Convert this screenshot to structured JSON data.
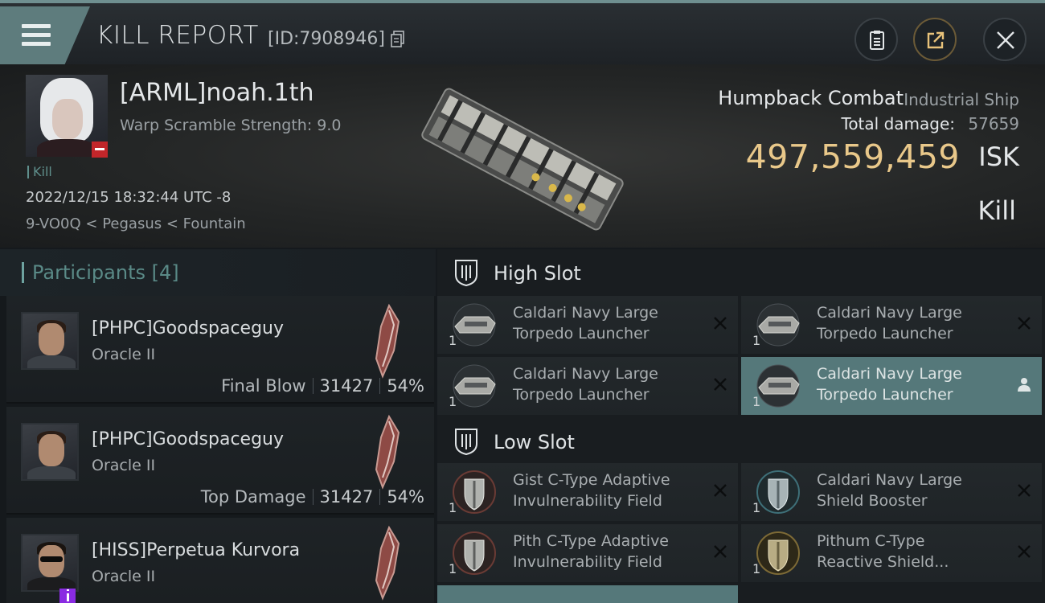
{
  "header": {
    "title": "KILL REPORT",
    "id_label": "[ID:7908946]"
  },
  "victim": {
    "name": "[ARML]noah.1th",
    "warp_scramble": "Warp Scramble Strength: 9.0",
    "tag": "Kill",
    "timestamp": "2022/12/15 18:32:44 UTC -8",
    "location": "9-VO0Q < Pegasus < Fountain",
    "ship_name": "Humpback Combat",
    "ship_class": "Industrial Ship",
    "total_damage_label": "Total damage:",
    "total_damage_value": "57659",
    "isk_value": "497,559,459",
    "isk_unit": "ISK",
    "result": "Kill"
  },
  "participants": {
    "title": "Participants",
    "count": "[4]",
    "rows": [
      {
        "name": "[PHPC]Goodspaceguy",
        "ship": "Oracle II",
        "label": "Final Blow",
        "damage": "31427",
        "percent": "54%"
      },
      {
        "name": "[PHPC]Goodspaceguy",
        "ship": "Oracle II",
        "label": "Top Damage",
        "damage": "31427",
        "percent": "54%"
      },
      {
        "name": "[HISS]Perpetua Kurvora",
        "ship": "Oracle II",
        "label": "",
        "damage": "",
        "percent": ""
      }
    ]
  },
  "fitting": {
    "high_slot": {
      "label": "High Slot",
      "modules": [
        {
          "line1": "Caldari Navy Large",
          "line2": "Torpedo Launcher",
          "qty": "1"
        },
        {
          "line1": "Caldari Navy Large",
          "line2": "Torpedo Launcher",
          "qty": "1"
        },
        {
          "line1": "Caldari Navy Large",
          "line2": "Torpedo Launcher",
          "qty": "1"
        },
        {
          "line1": "Caldari Navy Large",
          "line2": "Torpedo Launcher",
          "qty": "1"
        }
      ]
    },
    "low_slot": {
      "label": "Low Slot",
      "modules": [
        {
          "line1": "Gist C-Type Adaptive",
          "line2": "Invulnerability Field",
          "qty": "1"
        },
        {
          "line1": "Caldari Navy Large",
          "line2": "Shield Booster",
          "qty": "1"
        },
        {
          "line1": "Pith C-Type Adaptive",
          "line2": "Invulnerability Field",
          "qty": "1"
        },
        {
          "line1": "Pithum C-Type",
          "line2": "Reactive Shield...",
          "qty": "1"
        }
      ]
    }
  },
  "colors": {
    "accent": "#5e7c7d",
    "isk_gold": "#e9c88a",
    "selected_row": "#55787a",
    "badge_red": "#c2262a",
    "badge_purple": "#8a2be2"
  }
}
